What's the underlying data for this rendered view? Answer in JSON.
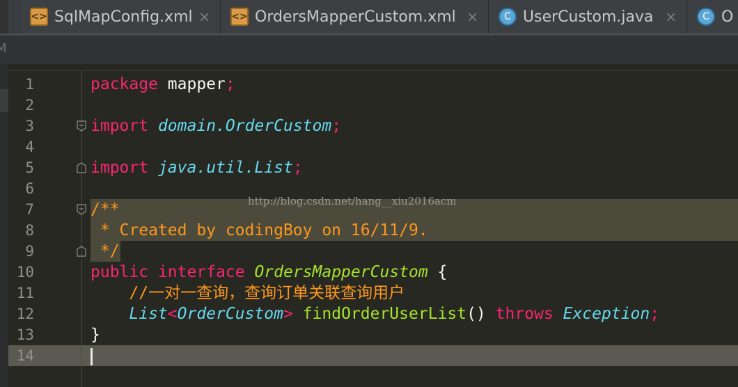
{
  "tabs": [
    {
      "label": "SqlMapConfig.xml",
      "icon": "xml-file-icon"
    },
    {
      "label": "OrdersMapperCustom.xml",
      "icon": "xml-file-icon"
    },
    {
      "label": "UserCustom.java",
      "icon": "java-class-icon"
    },
    {
      "label": "O",
      "icon": "java-class-icon"
    }
  ],
  "tab_close_glyph": "×",
  "xml_icon_glyph": "<>",
  "class_icon_glyph": "C",
  "breadcrumb": "M",
  "watermark": "http://blog.csdn.net/hang__xiu2016acm",
  "line_numbers": [
    "1",
    "2",
    "3",
    "4",
    "5",
    "6",
    "7",
    "8",
    "9",
    "10",
    "11",
    "12",
    "13",
    "14"
  ],
  "code": {
    "l1": [
      "package",
      " mapper",
      ";"
    ],
    "l3": [
      "import",
      " ",
      "domain.OrderCustom",
      ";"
    ],
    "l5": [
      "import",
      " ",
      "java.util.List",
      ";"
    ],
    "l7": [
      "/**"
    ],
    "l8": [
      " * Created by codingBoy on 16/11/9."
    ],
    "l9": [
      " */"
    ],
    "l10": [
      "public",
      " ",
      "interface",
      " ",
      "OrdersMapperCustom",
      " {"
    ],
    "l11": [
      "    ",
      "//一对一查询，查询订单关联查询用户"
    ],
    "l12": [
      "    ",
      "List",
      "<",
      "OrderCustom",
      ">",
      " ",
      "findOrderUserList",
      "()",
      " ",
      "throws",
      " ",
      "Exception",
      ";"
    ],
    "l13": [
      "}"
    ]
  },
  "colors": {
    "background": "#272822",
    "keyword": "#f92672",
    "type": "#66d9ef",
    "method": "#a6e22e",
    "comment": "#fd971f",
    "text": "#f8f8f2"
  }
}
